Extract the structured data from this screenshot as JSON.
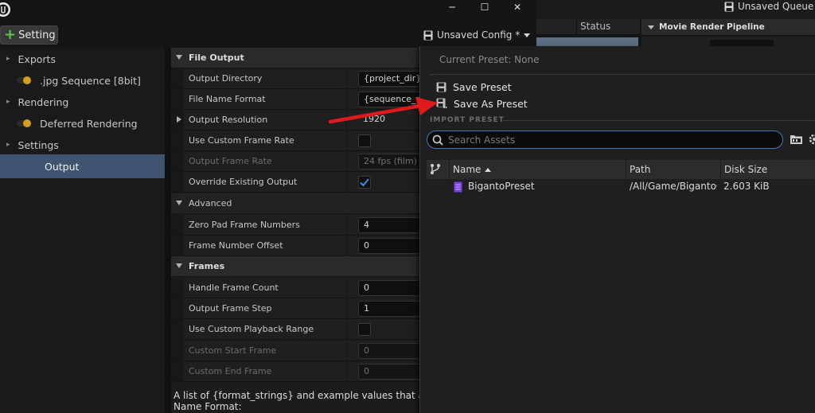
{
  "window": {
    "minimize_glyph": "─",
    "maximize_glyph": "☐",
    "close_glyph": "✕"
  },
  "toolbar": {
    "add_setting_label": "Setting",
    "config_label": "Unsaved Config *",
    "queue_label": "Unsaved Queue"
  },
  "queue": {
    "status_header": "Status",
    "pipeline_header": "Movie Render Pipeline"
  },
  "tree": {
    "items": [
      {
        "label": "Exports",
        "kind": "category"
      },
      {
        "label": ".jpg Sequence [8bit]",
        "kind": "setting",
        "enabled": true
      },
      {
        "label": "Rendering",
        "kind": "category"
      },
      {
        "label": "Deferred Rendering",
        "kind": "setting",
        "enabled": true
      },
      {
        "label": "Settings",
        "kind": "category"
      },
      {
        "label": "Output",
        "kind": "setting",
        "selected": true
      }
    ]
  },
  "details": {
    "file_output": {
      "header": "File Output",
      "output_directory": {
        "label": "Output Directory",
        "value": "{project_dir}/S"
      },
      "file_name_format": {
        "label": "File Name Format",
        "value": "{sequence_nam"
      },
      "output_resolution": {
        "label": "Output Resolution",
        "value": "1920"
      },
      "use_custom_frame_rate": {
        "label": "Use Custom Frame Rate",
        "checked": false
      },
      "output_frame_rate": {
        "label": "Output Frame Rate",
        "value": "24 fps (film)"
      },
      "override_existing": {
        "label": "Override Existing Output",
        "checked": true
      }
    },
    "advanced": {
      "header": "Advanced",
      "zero_pad": {
        "label": "Zero Pad Frame Numbers",
        "value": "4"
      },
      "frame_offset": {
        "label": "Frame Number Offset",
        "value": "0"
      }
    },
    "frames": {
      "header": "Frames",
      "handle_frame_count": {
        "label": "Handle Frame Count",
        "value": "0"
      },
      "output_frame_step": {
        "label": "Output Frame Step",
        "value": "1"
      },
      "use_custom_playback": {
        "label": "Use Custom Playback Range",
        "checked": false
      },
      "custom_start": {
        "label": "Custom Start Frame",
        "value": "0"
      },
      "custom_end": {
        "label": "Custom End Frame",
        "value": "0"
      }
    },
    "description_line1": "A list of {format_strings} and example values that are va",
    "description_line2": "Name Format:"
  },
  "menu": {
    "current_preset": "Current Preset: None",
    "save_preset": "Save Preset",
    "save_as_preset": "Save As Preset",
    "import_header": "IMPORT PRESET",
    "search_placeholder": "Search Assets",
    "columns": {
      "name": "Name",
      "path": "Path",
      "size": "Disk Size"
    },
    "assets": [
      {
        "name": "BigantoPreset",
        "path": "/All/Game/BigantoC",
        "size": "2.603 KiB"
      }
    ]
  },
  "colors": {
    "accent_blue": "#3e5470",
    "toggle_on": "#d79d1e",
    "add_green": "#5cc24a",
    "arrow_red": "#e0191c",
    "asset_purple": "#7b3fe4"
  }
}
